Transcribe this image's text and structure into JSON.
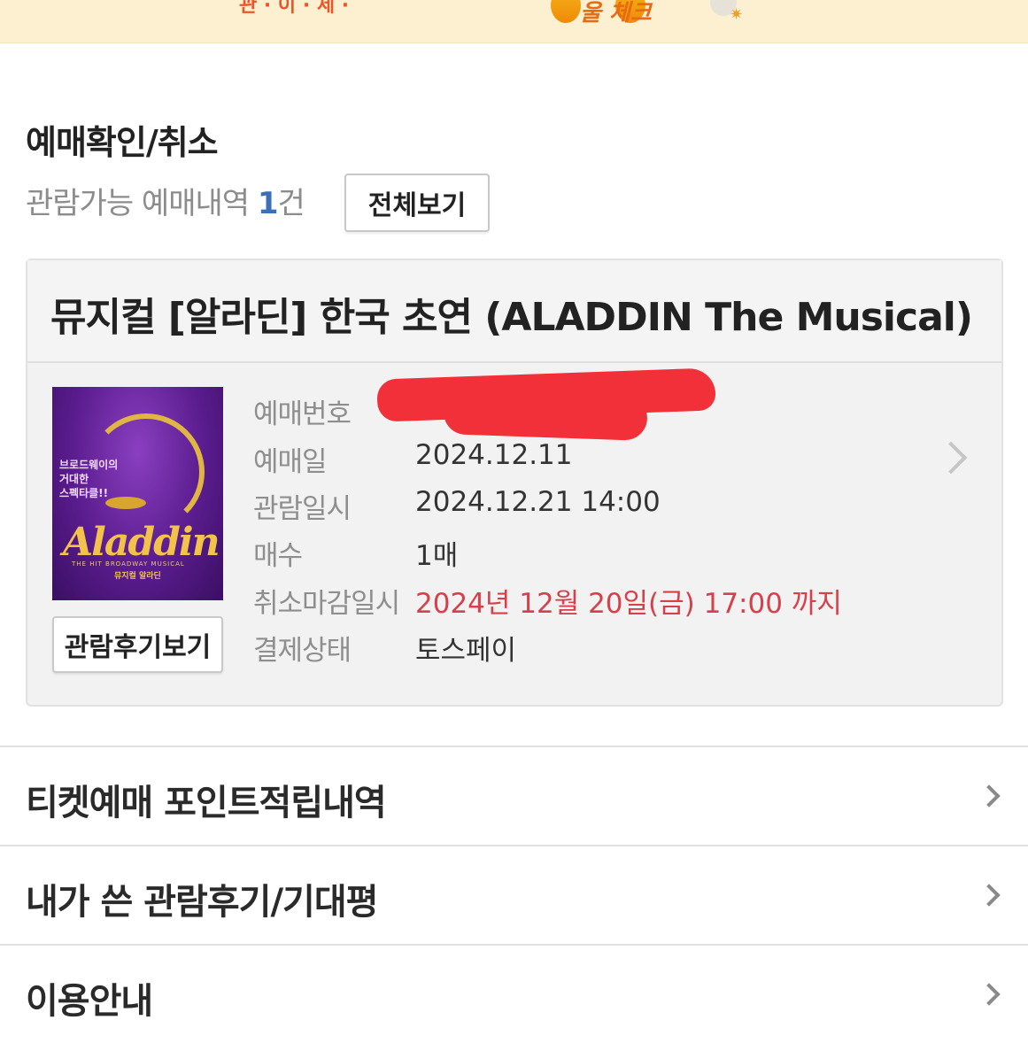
{
  "banner": {
    "text_left": "관 · 이 · 세 ·",
    "text_center": "울 체크"
  },
  "section": {
    "title": "예매확인/취소",
    "count_prefix": "관람가능 예매내역 ",
    "count": "1",
    "count_suffix": "건",
    "view_all_label": "전체보기"
  },
  "booking": {
    "title": "뮤지컬 [알라딘] 한국 초연 (ALADDIN The Musical)",
    "poster": {
      "tagline": "브로드웨이의\n거대한\n스펙타클!!",
      "logo": "Aladdin",
      "subtitle": "THE HIT BROADWAY MUSICAL",
      "subtitle_ko": "뮤지컬 알라딘"
    },
    "review_button_label": "관람후기보기",
    "rows": [
      {
        "label": "예매번호",
        "value": ""
      },
      {
        "label": "예매일",
        "value": "2024.12.11"
      },
      {
        "label": "관람일시",
        "value": "2024.12.21 14:00"
      },
      {
        "label": "매수",
        "value": "1매"
      },
      {
        "label": "취소마감일시",
        "value": "2024년 12월 20일(금) 17:00 까지"
      },
      {
        "label": "결제상태",
        "value": "토스페이"
      }
    ],
    "colors": {
      "deadline": "#d6404a",
      "accent_count": "#3d6fb6"
    }
  },
  "menu": [
    {
      "label": "티켓예매 포인트적립내역"
    },
    {
      "label": "내가 쓴 관람후기/기대평"
    },
    {
      "label": "이용안내"
    }
  ]
}
